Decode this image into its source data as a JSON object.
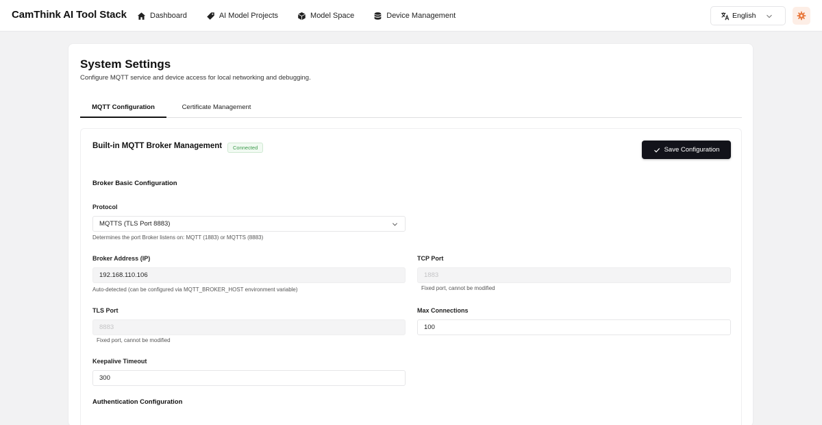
{
  "app": {
    "brand": "CamThink AI Tool Stack"
  },
  "nav": {
    "items": [
      {
        "label": "Dashboard",
        "icon": "home-icon"
      },
      {
        "label": "AI Model Projects",
        "icon": "tag-icon"
      },
      {
        "label": "Model Space",
        "icon": "cube-icon"
      },
      {
        "label": "Device Management",
        "icon": "database-icon"
      }
    ]
  },
  "language": {
    "selected": "English",
    "icon": "translate-icon"
  },
  "colors": {
    "accent": "#e8773a",
    "primary_button": "#12131a",
    "connected": "#3d9b4c"
  },
  "page": {
    "title": "System Settings",
    "subtitle": "Configure MQTT service and device access for local networking and debugging."
  },
  "tabs": [
    {
      "label": "MQTT Configuration",
      "active": true
    },
    {
      "label": "Certificate Management",
      "active": false
    }
  ],
  "broker": {
    "title": "Built-in MQTT Broker Management",
    "status": "Connected",
    "save_label": "Save Configuration",
    "basic_title": "Broker Basic Configuration",
    "auth_title": "Authentication Configuration",
    "protocol": {
      "label": "Protocol",
      "value": "MQTTS (TLS Port 8883)",
      "hint": "Determines the port Broker listens on: MQTT (1883) or MQTTS (8883)"
    },
    "address": {
      "label": "Broker Address (IP)",
      "value": "192.168.110.106",
      "hint": "Auto-detected (can be configured via MQTT_BROKER_HOST environment variable)"
    },
    "tcp_port": {
      "label": "TCP Port",
      "value": "1883",
      "hint": "Fixed port, cannot be modified"
    },
    "tls_port": {
      "label": "TLS Port",
      "value": "8883",
      "hint": "Fixed port, cannot be modified"
    },
    "max_connections": {
      "label": "Max Connections",
      "value": "100"
    },
    "keepalive": {
      "label": "Keepalive Timeout",
      "value": "300"
    }
  }
}
